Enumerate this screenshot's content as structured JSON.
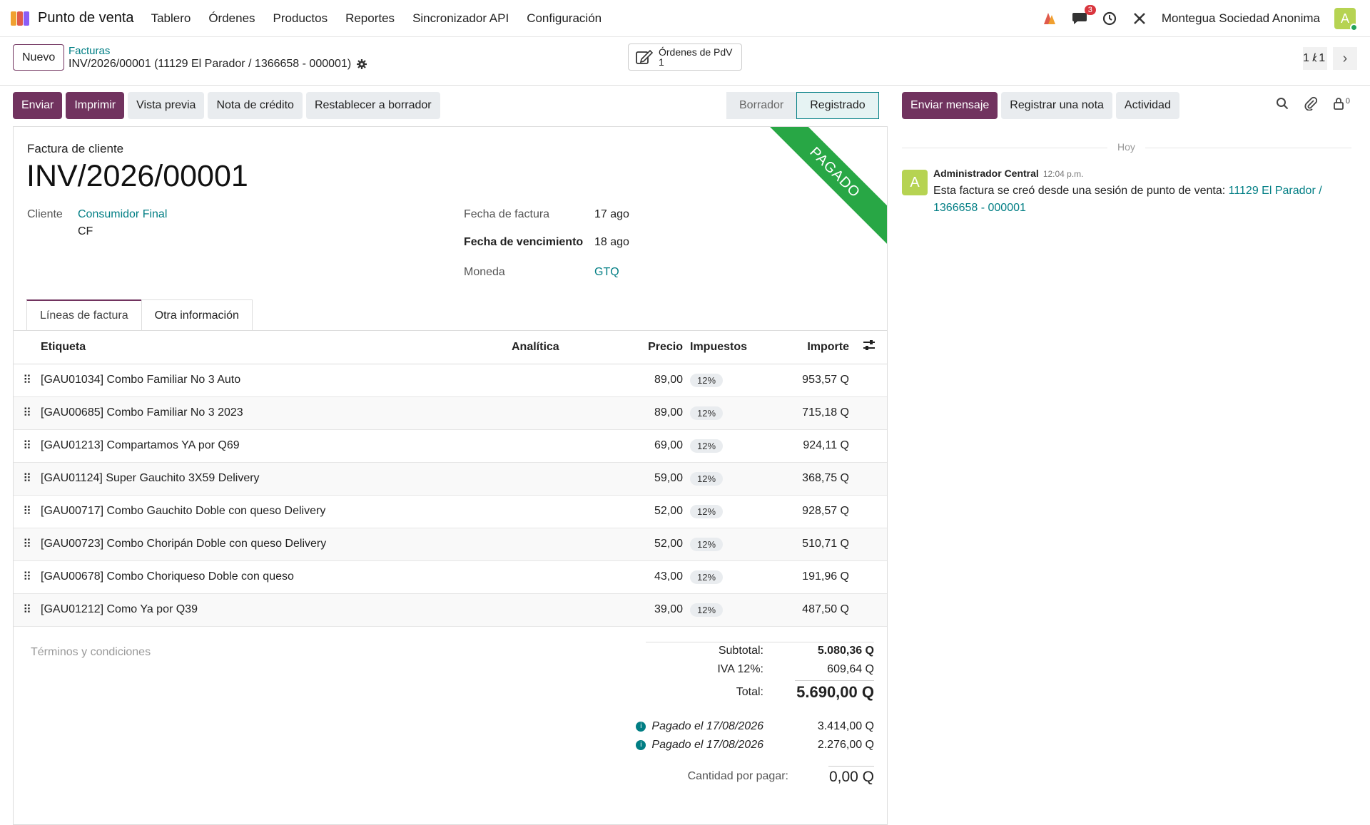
{
  "navbar": {
    "brand": "Punto de venta",
    "menu": [
      "Tablero",
      "Órdenes",
      "Productos",
      "Reportes",
      "Sincronizador API",
      "Configuración"
    ],
    "messages_badge": "3",
    "company": "Montegua Sociedad Anonima",
    "avatar_letter": "A"
  },
  "control_panel": {
    "new_button": "Nuevo",
    "breadcrumb_parent": "Facturas",
    "breadcrumb_current": "INV/2026/00001 (11129 El Parador / 1366658 - 000001)",
    "smart_button_label": "Órdenes de PdV",
    "smart_button_count": "1",
    "pager_value": "1 / 1"
  },
  "actions": {
    "send": "Enviar",
    "print": "Imprimir",
    "preview": "Vista previa",
    "credit_note": "Nota de crédito",
    "reset_draft": "Restablecer a borrador"
  },
  "status": {
    "draft": "Borrador",
    "posted": "Registrado"
  },
  "invoice": {
    "ribbon": "PAGADO",
    "type": "Factura de cliente",
    "name": "INV/2026/00001",
    "customer_label": "Cliente",
    "customer": "Consumidor Final",
    "customer_vat": "CF",
    "invoice_date_label": "Fecha de factura",
    "invoice_date": "17 ago",
    "due_date_label": "Fecha de vencimiento",
    "due_date": "18 ago",
    "currency_label": "Moneda",
    "currency": "GTQ"
  },
  "tabs": [
    "Líneas de factura",
    "Otra información"
  ],
  "table": {
    "headers": {
      "label": "Etiqueta",
      "analytic": "Analítica",
      "price": "Precio",
      "taxes": "Impuestos",
      "amount": "Importe"
    },
    "rows": [
      {
        "label": "[GAU01034] Combo Familiar No 3 Auto",
        "price": "89,00",
        "tax": "12%",
        "amount": "953,57 Q"
      },
      {
        "label": "[GAU00685] Combo Familiar No 3 2023",
        "price": "89,00",
        "tax": "12%",
        "amount": "715,18 Q"
      },
      {
        "label": "[GAU01213] Compartamos YA por Q69",
        "price": "69,00",
        "tax": "12%",
        "amount": "924,11 Q"
      },
      {
        "label": "[GAU01124] Super Gauchito 3X59 Delivery",
        "price": "59,00",
        "tax": "12%",
        "amount": "368,75 Q"
      },
      {
        "label": "[GAU00717] Combo Gauchito Doble con queso Delivery",
        "price": "52,00",
        "tax": "12%",
        "amount": "928,57 Q"
      },
      {
        "label": "[GAU00723] Combo Choripán Doble con queso Delivery",
        "price": "52,00",
        "tax": "12%",
        "amount": "510,71 Q"
      },
      {
        "label": "[GAU00678] Combo Choriqueso Doble con queso",
        "price": "43,00",
        "tax": "12%",
        "amount": "191,96 Q"
      },
      {
        "label": "[GAU01212] Como Ya por Q39",
        "price": "39,00",
        "tax": "12%",
        "amount": "487,50 Q"
      }
    ]
  },
  "footer": {
    "terms_placeholder": "Términos y condiciones",
    "subtotal_label": "Subtotal:",
    "subtotal": "5.080,36 Q",
    "iva_label": "IVA 12%:",
    "iva": "609,64 Q",
    "total_label": "Total:",
    "total": "5.690,00 Q",
    "payments": [
      {
        "label": "Pagado el 17/08/2026",
        "amount": "3.414,00 Q"
      },
      {
        "label": "Pagado el 17/08/2026",
        "amount": "2.276,00 Q"
      }
    ],
    "due_label": "Cantidad por pagar:",
    "due": "0,00 Q"
  },
  "chatter": {
    "send_message": "Enviar mensaje",
    "log_note": "Registrar una nota",
    "activity": "Actividad",
    "followers_count": "0",
    "separator": "Hoy",
    "message": {
      "avatar_letter": "A",
      "author": "Administrador Central",
      "time": "12:04 p.m.",
      "text": "Esta factura se creó desde una sesión de punto de venta: ",
      "link": "11129 El Parador / 1366658 - 000001"
    }
  },
  "colors": {
    "primary": "#71335f",
    "link": "#017e84",
    "ribbon": "#28a745"
  }
}
